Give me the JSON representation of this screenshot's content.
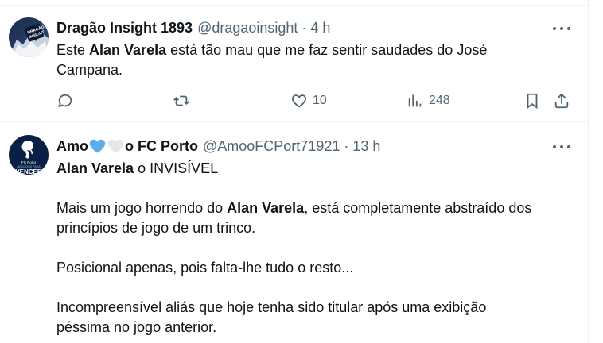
{
  "tweets": [
    {
      "author_name": "Dragão Insight 1893",
      "handle": "@dragaoinsight",
      "separator": "·",
      "time": "4 h",
      "text_parts": [
        "Este ",
        "Alan Varela",
        " está tão mau que me faz sentir saudades do José",
        "Campana."
      ],
      "actions": {
        "likes": "10",
        "views": "248"
      }
    },
    {
      "author_name_part1": "Amo",
      "author_name_part2": "o FC Porto",
      "handle": "@AmooFCPort71921",
      "separator": "·",
      "time": "13 h",
      "avatar_text_top": "FC Porto",
      "avatar_text_mid": "NASCIDOS PARA",
      "avatar_text_bottom": "VENCER",
      "lines": {
        "l1_bold": "Alan Varela",
        "l1_rest": " o INVISÍVEL",
        "l2_a": "Mais um jogo horrendo do ",
        "l2_bold": "Alan Varela",
        "l2_b": ", está completamente abstraído dos",
        "l3": "princípios de jogo de um trinco.",
        "l4": "Posicional apenas, pois falta-lhe tudo o resto...",
        "l5": "Incompreensível aliás que hoje tenha sido titular após uma exibição",
        "l6": "péssima no jogo anterior."
      }
    }
  ],
  "icons": {
    "reply": "reply-icon",
    "retweet": "retweet-icon",
    "like": "like-icon",
    "views": "views-icon",
    "bookmark": "bookmark-icon",
    "share": "share-icon",
    "more": "more-icon"
  },
  "colors": {
    "text": "#0f1419",
    "secondary": "#536471",
    "border": "#eff3f4",
    "blue_heart": "#5dadec",
    "white_heart": "#e6e7e8"
  }
}
